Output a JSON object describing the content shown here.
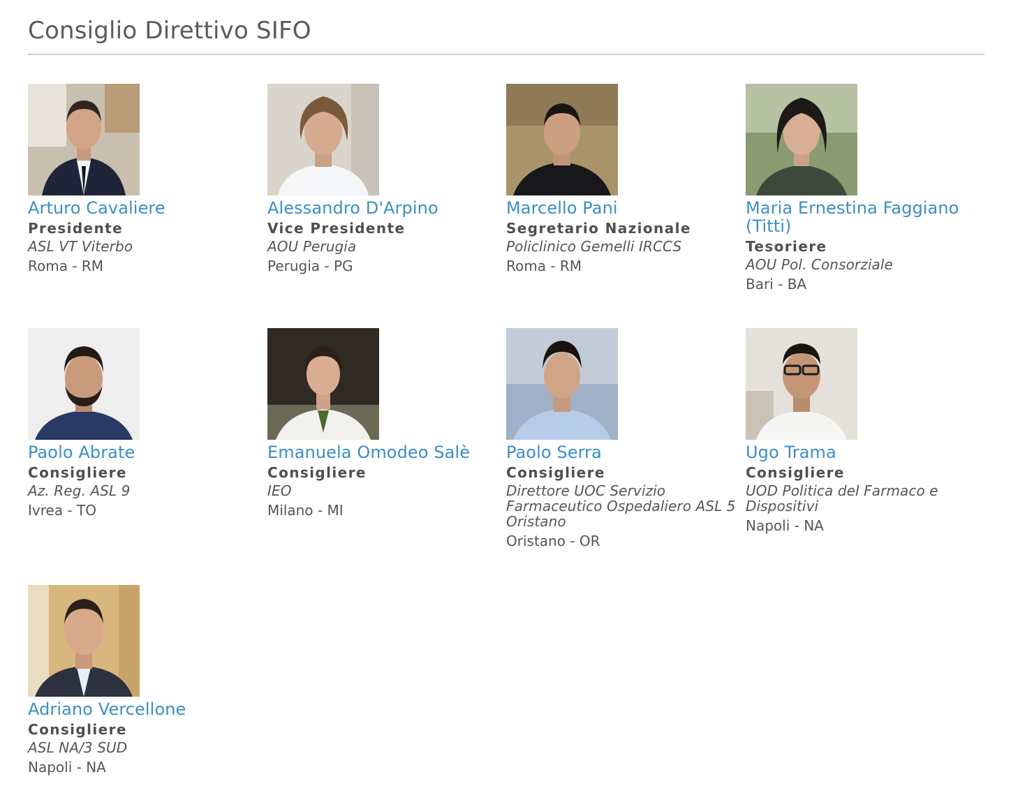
{
  "page": {
    "title": "Consiglio Direttivo SIFO"
  },
  "colors": {
    "name_link": "#3a8fc4",
    "text": "#555555",
    "rule": "#cfcfcf"
  },
  "members": [
    {
      "name": "Arturo Cavaliere",
      "role": "Presidente",
      "org": "ASL VT Viterbo",
      "city": "Roma - RM"
    },
    {
      "name": "Alessandro D'Arpino",
      "role": "Vice Presidente",
      "org": "AOU Perugia",
      "city": "Perugia - PG"
    },
    {
      "name": "Marcello Pani",
      "role": "Segretario Nazionale",
      "org": "Policlinico Gemelli IRCCS",
      "city": "Roma - RM"
    },
    {
      "name": "Maria Ernestina Faggiano (Titti)",
      "role": "Tesoriere",
      "org": "AOU Pol. Consorziale",
      "city": "Bari - BA"
    },
    {
      "name": "Paolo Abrate",
      "role": "Consigliere",
      "org": "Az. Reg. ASL 9",
      "city": "Ivrea - TO"
    },
    {
      "name": "Emanuela Omodeo Salè",
      "role": "Consigliere",
      "org": "IEO",
      "city": "Milano - MI"
    },
    {
      "name": "Paolo Serra",
      "role": "Consigliere",
      "org": "Direttore UOC Servizio Farmaceutico Ospedaliero ASL 5 Oristano",
      "city": "Oristano - OR"
    },
    {
      "name": "Ugo Trama",
      "role": "Consigliere",
      "org": "UOD Politica del Farmaco e Dispositivi",
      "city": "Napoli - NA"
    },
    {
      "name": "Adriano Vercellone",
      "role": "Consigliere",
      "org": "ASL NA/3 SUD",
      "city": "Napoli - NA"
    }
  ]
}
